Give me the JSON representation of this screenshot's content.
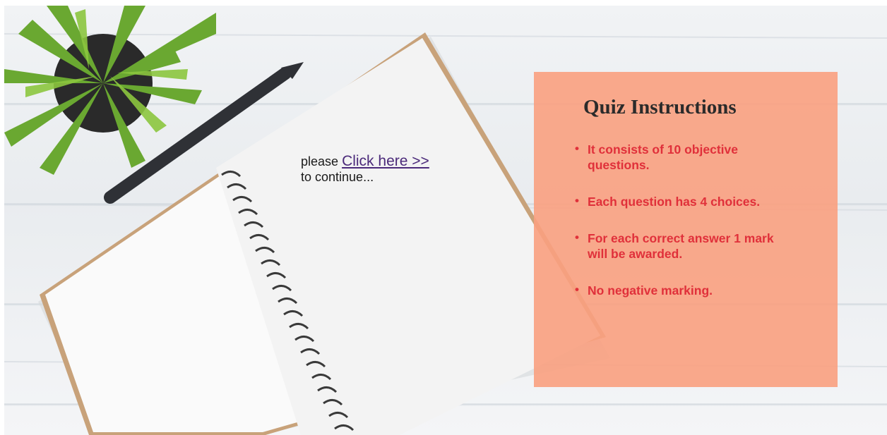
{
  "prompt": {
    "prefix": "please",
    "link_label": "Click here >>",
    "suffix": "to continue..."
  },
  "instructions": {
    "title": "Quiz Instructions",
    "items": [
      "It consists of 10 objective questions.",
      "Each question has 4 choices.",
      "For each correct answer 1 mark will be awarded.",
      "No negative marking."
    ]
  },
  "colors": {
    "panel_bg": "#faa080",
    "item_text": "#e0303a",
    "link": "#4b2a7a"
  }
}
